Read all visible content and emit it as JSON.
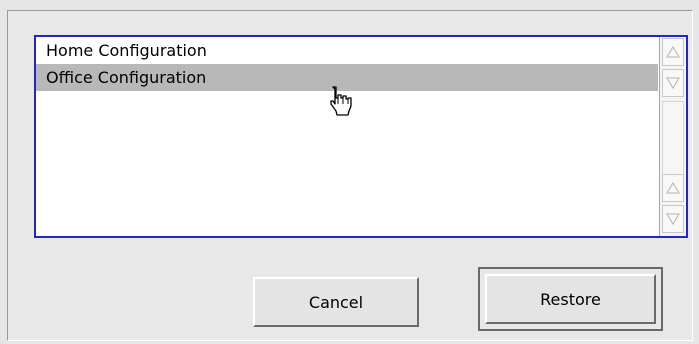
{
  "configurations": {
    "items": [
      {
        "label": "Home Configuration",
        "selected": false
      },
      {
        "label": "Office Configuration",
        "selected": true
      }
    ]
  },
  "buttons": {
    "cancel_label": "Cancel",
    "restore_label": "Restore"
  },
  "colors": {
    "list_border": "#2424c8",
    "selection": "#b8b8b8"
  },
  "icons": {
    "cursor": "hand-pointer-icon",
    "scroll_up": "triangle-up-icon",
    "scroll_down": "triangle-down-icon"
  }
}
